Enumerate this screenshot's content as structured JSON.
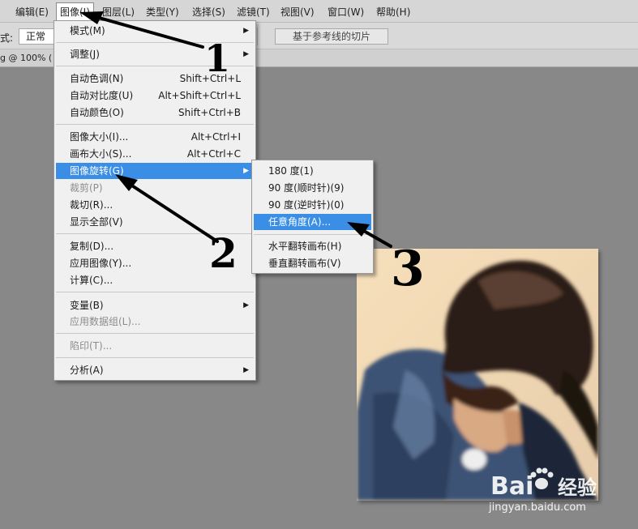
{
  "menubar": {
    "items": [
      "编辑(E)",
      "图像(I)",
      "图层(L)",
      "类型(Y)",
      "选择(S)",
      "滤镜(T)",
      "视图(V)",
      "窗口(W)",
      "帮助(H)"
    ]
  },
  "options": {
    "label_partial": "式:",
    "style_value": "正常",
    "slice_button": "基于参考线的切片"
  },
  "doc_tab": {
    "label": "g @ 100% ("
  },
  "image_menu": {
    "mode": "模式(M)",
    "adjust": "调整(J)",
    "auto_tone": "自动色调(N)",
    "auto_tone_sc": "Shift+Ctrl+L",
    "auto_contrast": "自动对比度(U)",
    "auto_contrast_sc": "Alt+Shift+Ctrl+L",
    "auto_color": "自动颜色(O)",
    "auto_color_sc": "Shift+Ctrl+B",
    "image_size": "图像大小(I)...",
    "image_size_sc": "Alt+Ctrl+I",
    "canvas_size": "画布大小(S)...",
    "canvas_size_sc": "Alt+Ctrl+C",
    "rotation": "图像旋转(G)",
    "crop": "裁剪(P)",
    "trim": "裁切(R)...",
    "reveal_all": "显示全部(V)",
    "duplicate": "复制(D)...",
    "apply_image": "应用图像(Y)...",
    "calculations": "计算(C)...",
    "variables": "变量(B)",
    "apply_dataset": "应用数据组(L)...",
    "trap": "陷印(T)...",
    "analysis": "分析(A)"
  },
  "rotate_menu": {
    "r180": "180 度(1)",
    "r90cw": "90 度(顺时针)(9)",
    "r90ccw": "90 度(逆时针)(0)",
    "arbitrary": "任意角度(A)...",
    "flip_h": "水平翻转画布(H)",
    "flip_v": "垂直翻转画布(V)"
  },
  "annotations": {
    "n1": "1",
    "n2": "2",
    "n3": "3"
  },
  "watermark": {
    "brand": "Bai",
    "brand_cn": "经验",
    "url": "jingyan.baidu.com"
  },
  "colors": {
    "highlight": "#3a8ee6",
    "menu_bg": "#f0f0f0",
    "workspace": "#888888"
  }
}
